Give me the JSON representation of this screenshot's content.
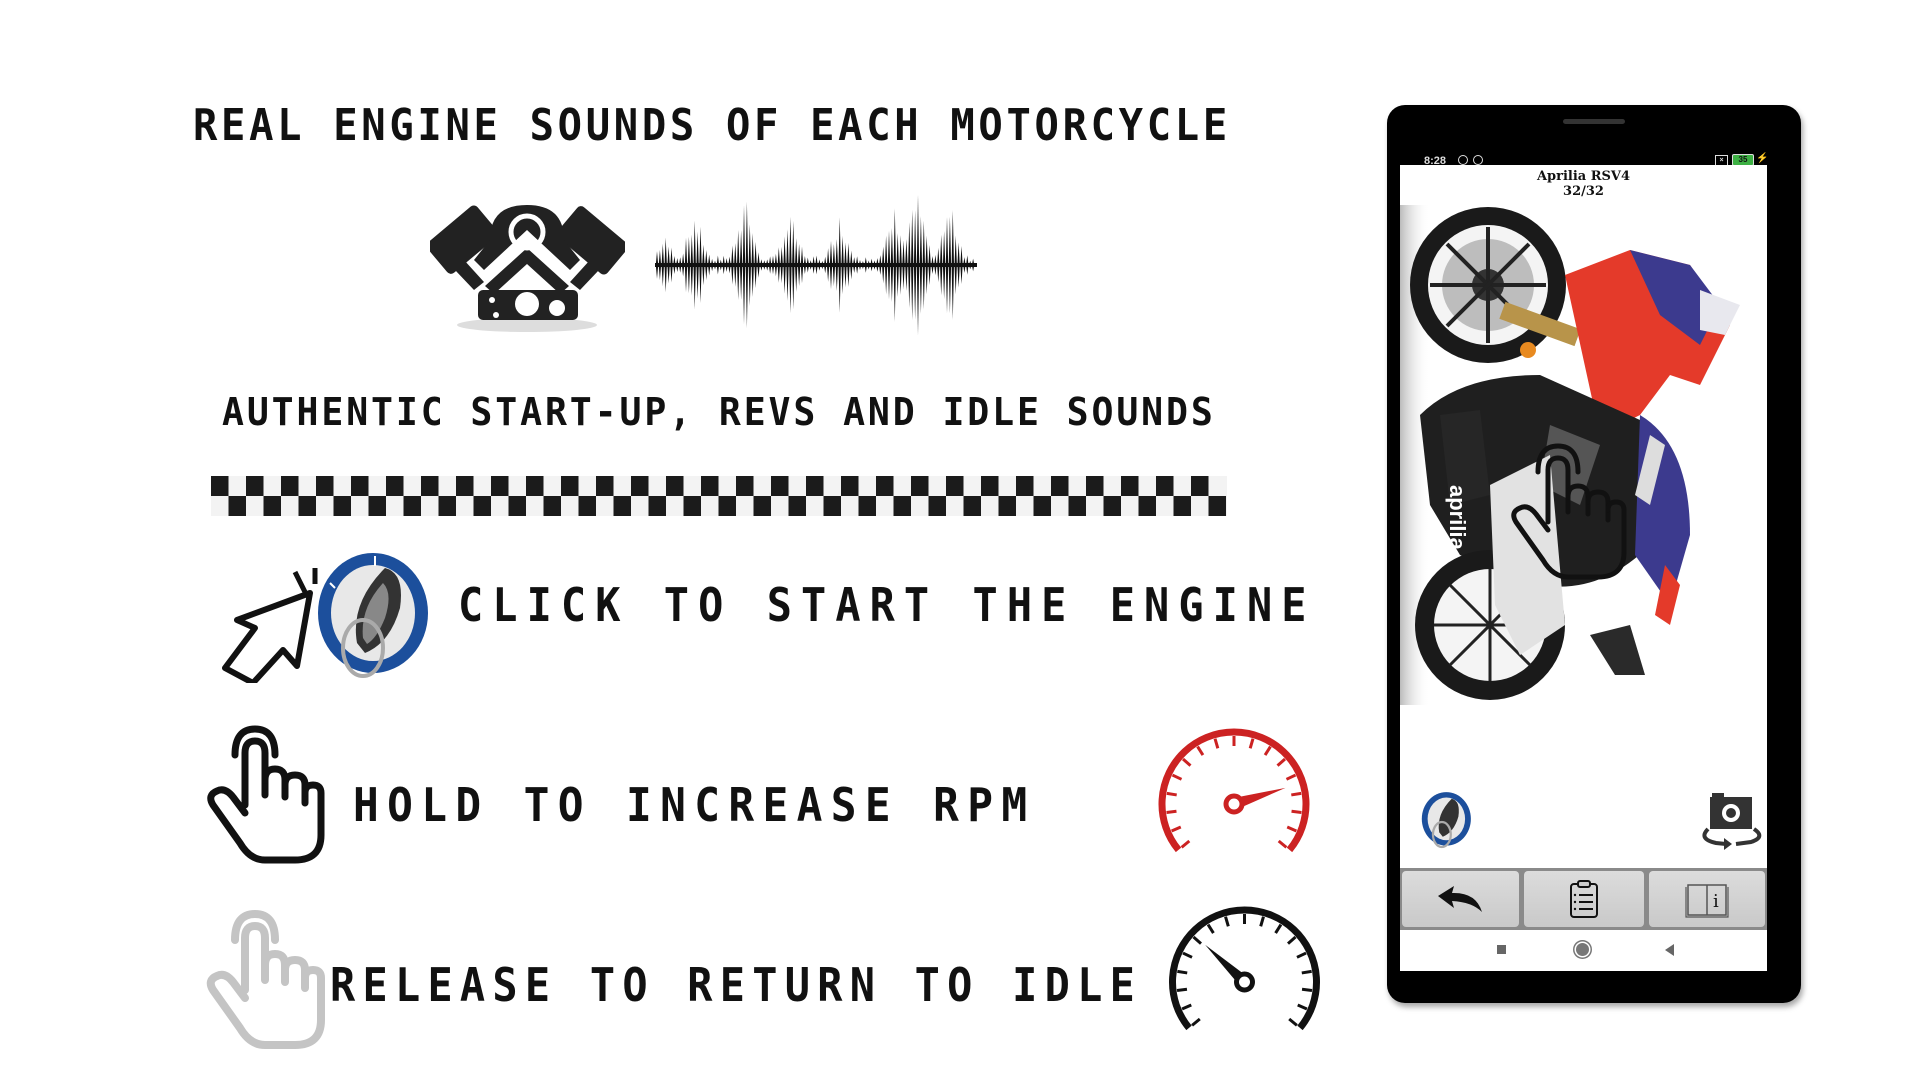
{
  "headline": "REAL ENGINE SOUNDS OF EACH MOTORCYCLE",
  "subheadline": "AUTHENTIC START-UP, REVS AND IDLE SOUNDS",
  "instructions": [
    {
      "text": "CLICK TO START THE ENGINE",
      "icon": "ignition-key-icon"
    },
    {
      "text": "HOLD TO INCREASE RPM",
      "icon": "hold-hand-icon",
      "gauge": "high-rpm-gauge-icon"
    },
    {
      "text": "RELEASE TO RETURN TO IDLE",
      "icon": "release-hand-icon",
      "gauge": "idle-gauge-icon"
    }
  ],
  "colors": {
    "text": "#111111",
    "gauge_high": "#cc2222",
    "gauge_idle": "#111111",
    "key_ring_blue": "#1c4f9c",
    "battery_green": "#3cb043"
  },
  "phone": {
    "status_bar": {
      "time": "8:28",
      "battery": "35"
    },
    "bike_name": "Aprilia RSV4",
    "bike_counter": "32/32",
    "buttons": [
      {
        "name": "back",
        "icon": "back-arrow-icon"
      },
      {
        "name": "specs",
        "icon": "clipboard-list-icon"
      },
      {
        "name": "info",
        "icon": "book-info-icon"
      }
    ],
    "overlay_icons": [
      "ignition-key-icon",
      "rotate-camera-icon",
      "pointing-hand-icon"
    ],
    "nav": [
      "recents-square-icon",
      "home-circle-icon",
      "back-triangle-icon"
    ]
  }
}
